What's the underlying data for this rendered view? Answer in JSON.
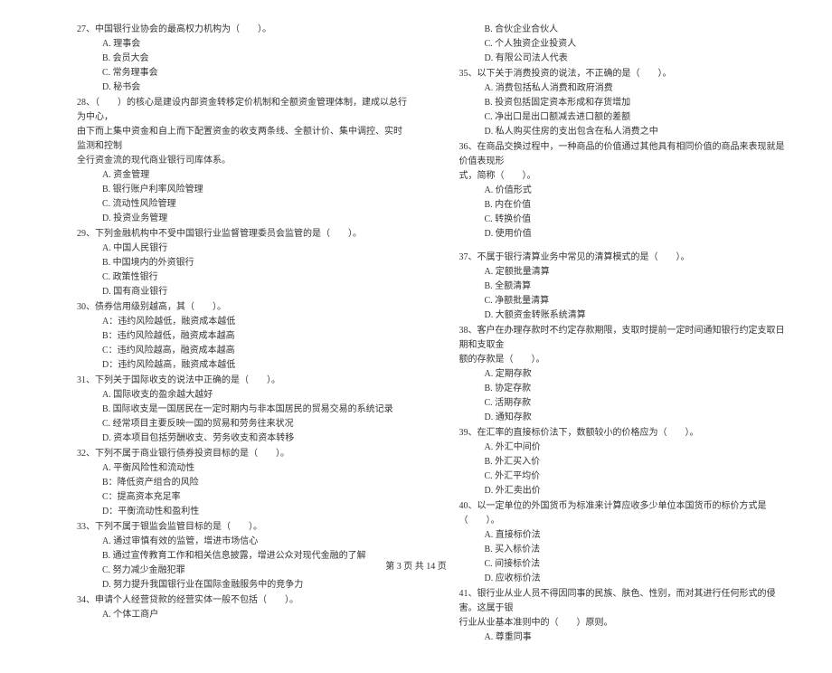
{
  "left": {
    "q27": {
      "stem": "27、中国银行业协会的最高权力机构为（　　）。",
      "opts": [
        "A. 理事会",
        "B. 会员大会",
        "C. 常务理事会",
        "D. 秘书会"
      ]
    },
    "q28": {
      "stem": "28、（　　）的核心是建设内部资金转移定价机制和全额资金管理体制，建成以总行为中心，",
      "cont1": "由下而上集中资金和自上而下配置资金的收支两条线、全额计价、集中调控、实时监测和控制",
      "cont2": "全行资金流的现代商业银行司库体系。",
      "opts": [
        "A. 资金管理",
        "B. 银行账户利率风险管理",
        "C. 流动性风险管理",
        "D. 投资业务管理"
      ]
    },
    "q29": {
      "stem": "29、下列金融机构中不受中国银行业监督管理委员会监管的是（　　）。",
      "opts": [
        "A. 中国人民银行",
        "B. 中国境内的外资银行",
        "C. 政策性银行",
        "D. 国有商业银行"
      ]
    },
    "q30": {
      "stem": "30、债券信用级别越高，其（　　）。",
      "opts": [
        "A：违约风险越低，融资成本越低",
        "B：违约风险越低，融资成本越高",
        "C：违约风险越高，融资成本越高",
        "D：违约风险越高，融资成本越低"
      ]
    },
    "q31": {
      "stem": "31、下列关于国际收支的说法中正确的是（　　）。",
      "opts": [
        "A. 国际收支的盈余越大越好",
        "B. 国际收支是一国居民在一定时期内与非本国居民的贸易交易的系统记录",
        "C. 经常项目主要反映一国的贸易和劳务往来状况",
        "D. 资本项目包括劳酬收支、劳务收支和资本转移"
      ]
    },
    "q32": {
      "stem": "32、下列不属于商业银行债券投资目标的是（　　）。",
      "opts": [
        "A. 平衡风险性和流动性",
        "B：降低资产组合的风险",
        "C：提高资本充足率",
        "D：平衡流动性和盈利性"
      ]
    },
    "q33": {
      "stem": "33、下列不属于银监会监管目标的是（　　）。",
      "opts": [
        "A. 通过审慎有效的监管，增进市场信心",
        "B. 通过宣传教育工作和相关信息披露，增进公众对现代金融的了解",
        "C. 努力减少金融犯罪",
        "D. 努力提升我国银行业在国际金融服务中的竞争力"
      ]
    },
    "q34": {
      "stem": "34、申请个人经营贷款的经营实体一般不包括（　　）。",
      "opts": [
        "A. 个体工商户"
      ]
    }
  },
  "right": {
    "q34r": {
      "opts": [
        "B. 合伙企业合伙人",
        "C. 个人独资企业投资人",
        "D. 有限公司法人代表"
      ]
    },
    "q35": {
      "stem": "35、以下关于消费投资的说法，不正确的是（　　）。",
      "opts": [
        "A. 消费包括私人消费和政府消费",
        "B. 投资包括固定资本形成和存货增加",
        "C. 净出口是出口额减去进口额的差额",
        "D. 私人购买住房的支出包含在私人消费之中"
      ]
    },
    "q36": {
      "stem": "36、在商品交换过程中，一种商品的价值通过其他具有相同价值的商品来表现就是价值表现形",
      "cont1": "式，简称（　　）。",
      "opts": [
        "A. 价值形式",
        "B. 内在价值",
        "C. 转换价值",
        "D. 使用价值"
      ]
    },
    "q37": {
      "stem": "37、不属于银行清算业务中常见的清算模式的是（　　）。",
      "opts": [
        "A. 定额批量清算",
        "B. 全额清算",
        "C. 净额批量清算",
        "D. 大额资金转账系统清算"
      ]
    },
    "q38": {
      "stem": "38、客户在办理存款时不约定存款期限，支取时提前一定时间通知银行约定支取日期和支取金",
      "cont1": "额的存款是（　　）。",
      "opts": [
        "A. 定期存款",
        "B. 协定存款",
        "C. 活期存款",
        "D. 通知存款"
      ]
    },
    "q39": {
      "stem": "39、在汇率的直接标价法下，数额较小的价格应为（　　）。",
      "opts": [
        "A. 外汇中间价",
        "B. 外汇买入价",
        "C. 外汇平均价",
        "D. 外汇卖出价"
      ]
    },
    "q40": {
      "stem": "40、以一定单位的外国货币为标准来计算应收多少单位本国货币的标价方式是（　　）。",
      "opts": [
        "A. 直接标价法",
        "B. 买入标价法",
        "C. 间接标价法",
        "D. 应收标价法"
      ]
    },
    "q41": {
      "stem": "41、银行业从业人员不得因同事的民族、肤色、性别，而对其进行任何形式的侵害。这属于银",
      "cont1": "行业从业基本准则中的（　　）原则。",
      "opts": [
        "A. 尊重同事"
      ]
    }
  },
  "footer": "第 3 页 共 14 页"
}
